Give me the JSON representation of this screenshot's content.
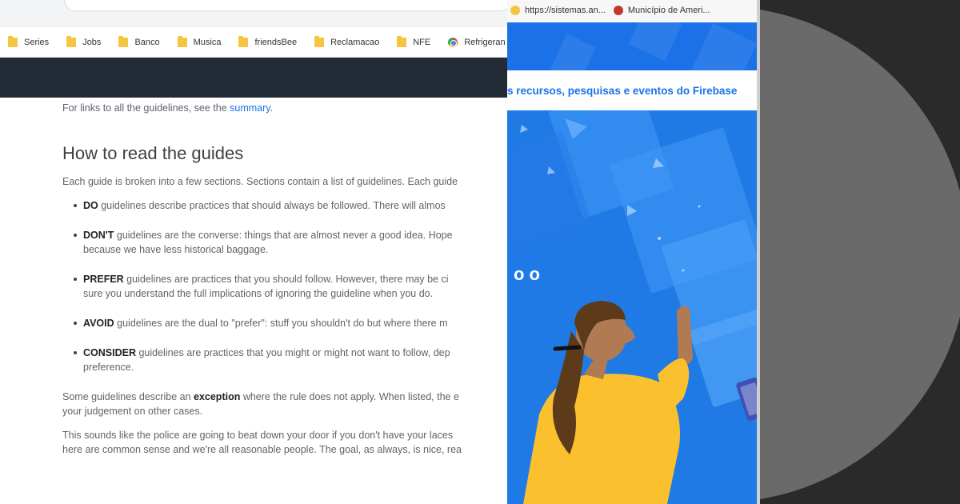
{
  "left_browser": {
    "bookmarks": [
      "Series",
      "Jobs",
      "Banco",
      "Musica",
      "friendsBee",
      "Reclamacao",
      "NFE",
      "Refrigeran"
    ],
    "bookmark_icons": [
      "folder-icon",
      "folder-icon",
      "folder-icon",
      "folder-icon",
      "folder-icon",
      "folder-icon",
      "folder-icon",
      "chrome-icon"
    ]
  },
  "doc": {
    "intro_text": "For links to all the guidelines, see the ",
    "intro_link": "summary",
    "intro_end": ".",
    "heading": "How to read the guides",
    "lead": "Each guide is broken into a few sections. Sections contain a list of guidelines. Each guide",
    "items": [
      {
        "keyword": "DO",
        "text": " guidelines describe practices that should always be followed. There will almos",
        "line2": ""
      },
      {
        "keyword": "DON'T",
        "text": " guidelines are the converse: things that are almost never a good idea. Hope",
        "line2": "because we have less historical baggage."
      },
      {
        "keyword": "PREFER",
        "text": " guidelines are practices that you should follow. However, there may be ci",
        "line2": "sure you understand the full implications of ignoring the guideline when you do."
      },
      {
        "keyword": "AVOID",
        "text": " guidelines are the dual to \"prefer\": stuff you shouldn't do but where there m",
        "line2": ""
      },
      {
        "keyword": "CONSIDER",
        "text": " guidelines are practices that you might or might not want to follow, dep",
        "line2": "preference."
      }
    ],
    "exception_pre": "Some guidelines describe an ",
    "exception_word": "exception",
    "exception_post": " where the rule does not apply. When listed, the e",
    "exception_line2": "your judgement on other cases.",
    "closing_line1": "This sounds like the police are going to beat down your door if you don't have your laces",
    "closing_line2": "here are common sense and we're all reasonable people. The goal, as always, is nice, rea"
  },
  "mid_browser": {
    "tabs": [
      "https://sistemas.an...",
      "Município de Ameri..."
    ],
    "subtitle": "s recursos, pesquisas e eventos do Firebase",
    "hero_glyphs": "oo"
  },
  "colors": {
    "firebase_blue": "#1f7ae6",
    "link_blue": "#1a73e8",
    "dark_bar": "#222b36",
    "sweater_yellow": "#fbc02d",
    "hair_brown": "#5d3a1a"
  }
}
